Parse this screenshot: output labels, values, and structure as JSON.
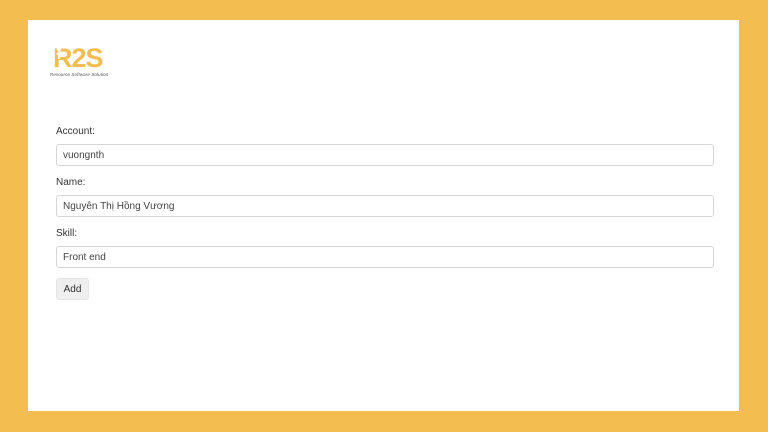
{
  "brand": {
    "logo_text": "R2S",
    "tagline": "Resource Software Solution",
    "color": "#F4BD4F"
  },
  "form": {
    "account": {
      "label": "Account:",
      "value": "vuongnth"
    },
    "name": {
      "label": "Name:",
      "value": "Nguyễn Thị Hồng Vương"
    },
    "skill": {
      "label": "Skill:",
      "value": "Front end"
    },
    "add_label": "Add"
  }
}
